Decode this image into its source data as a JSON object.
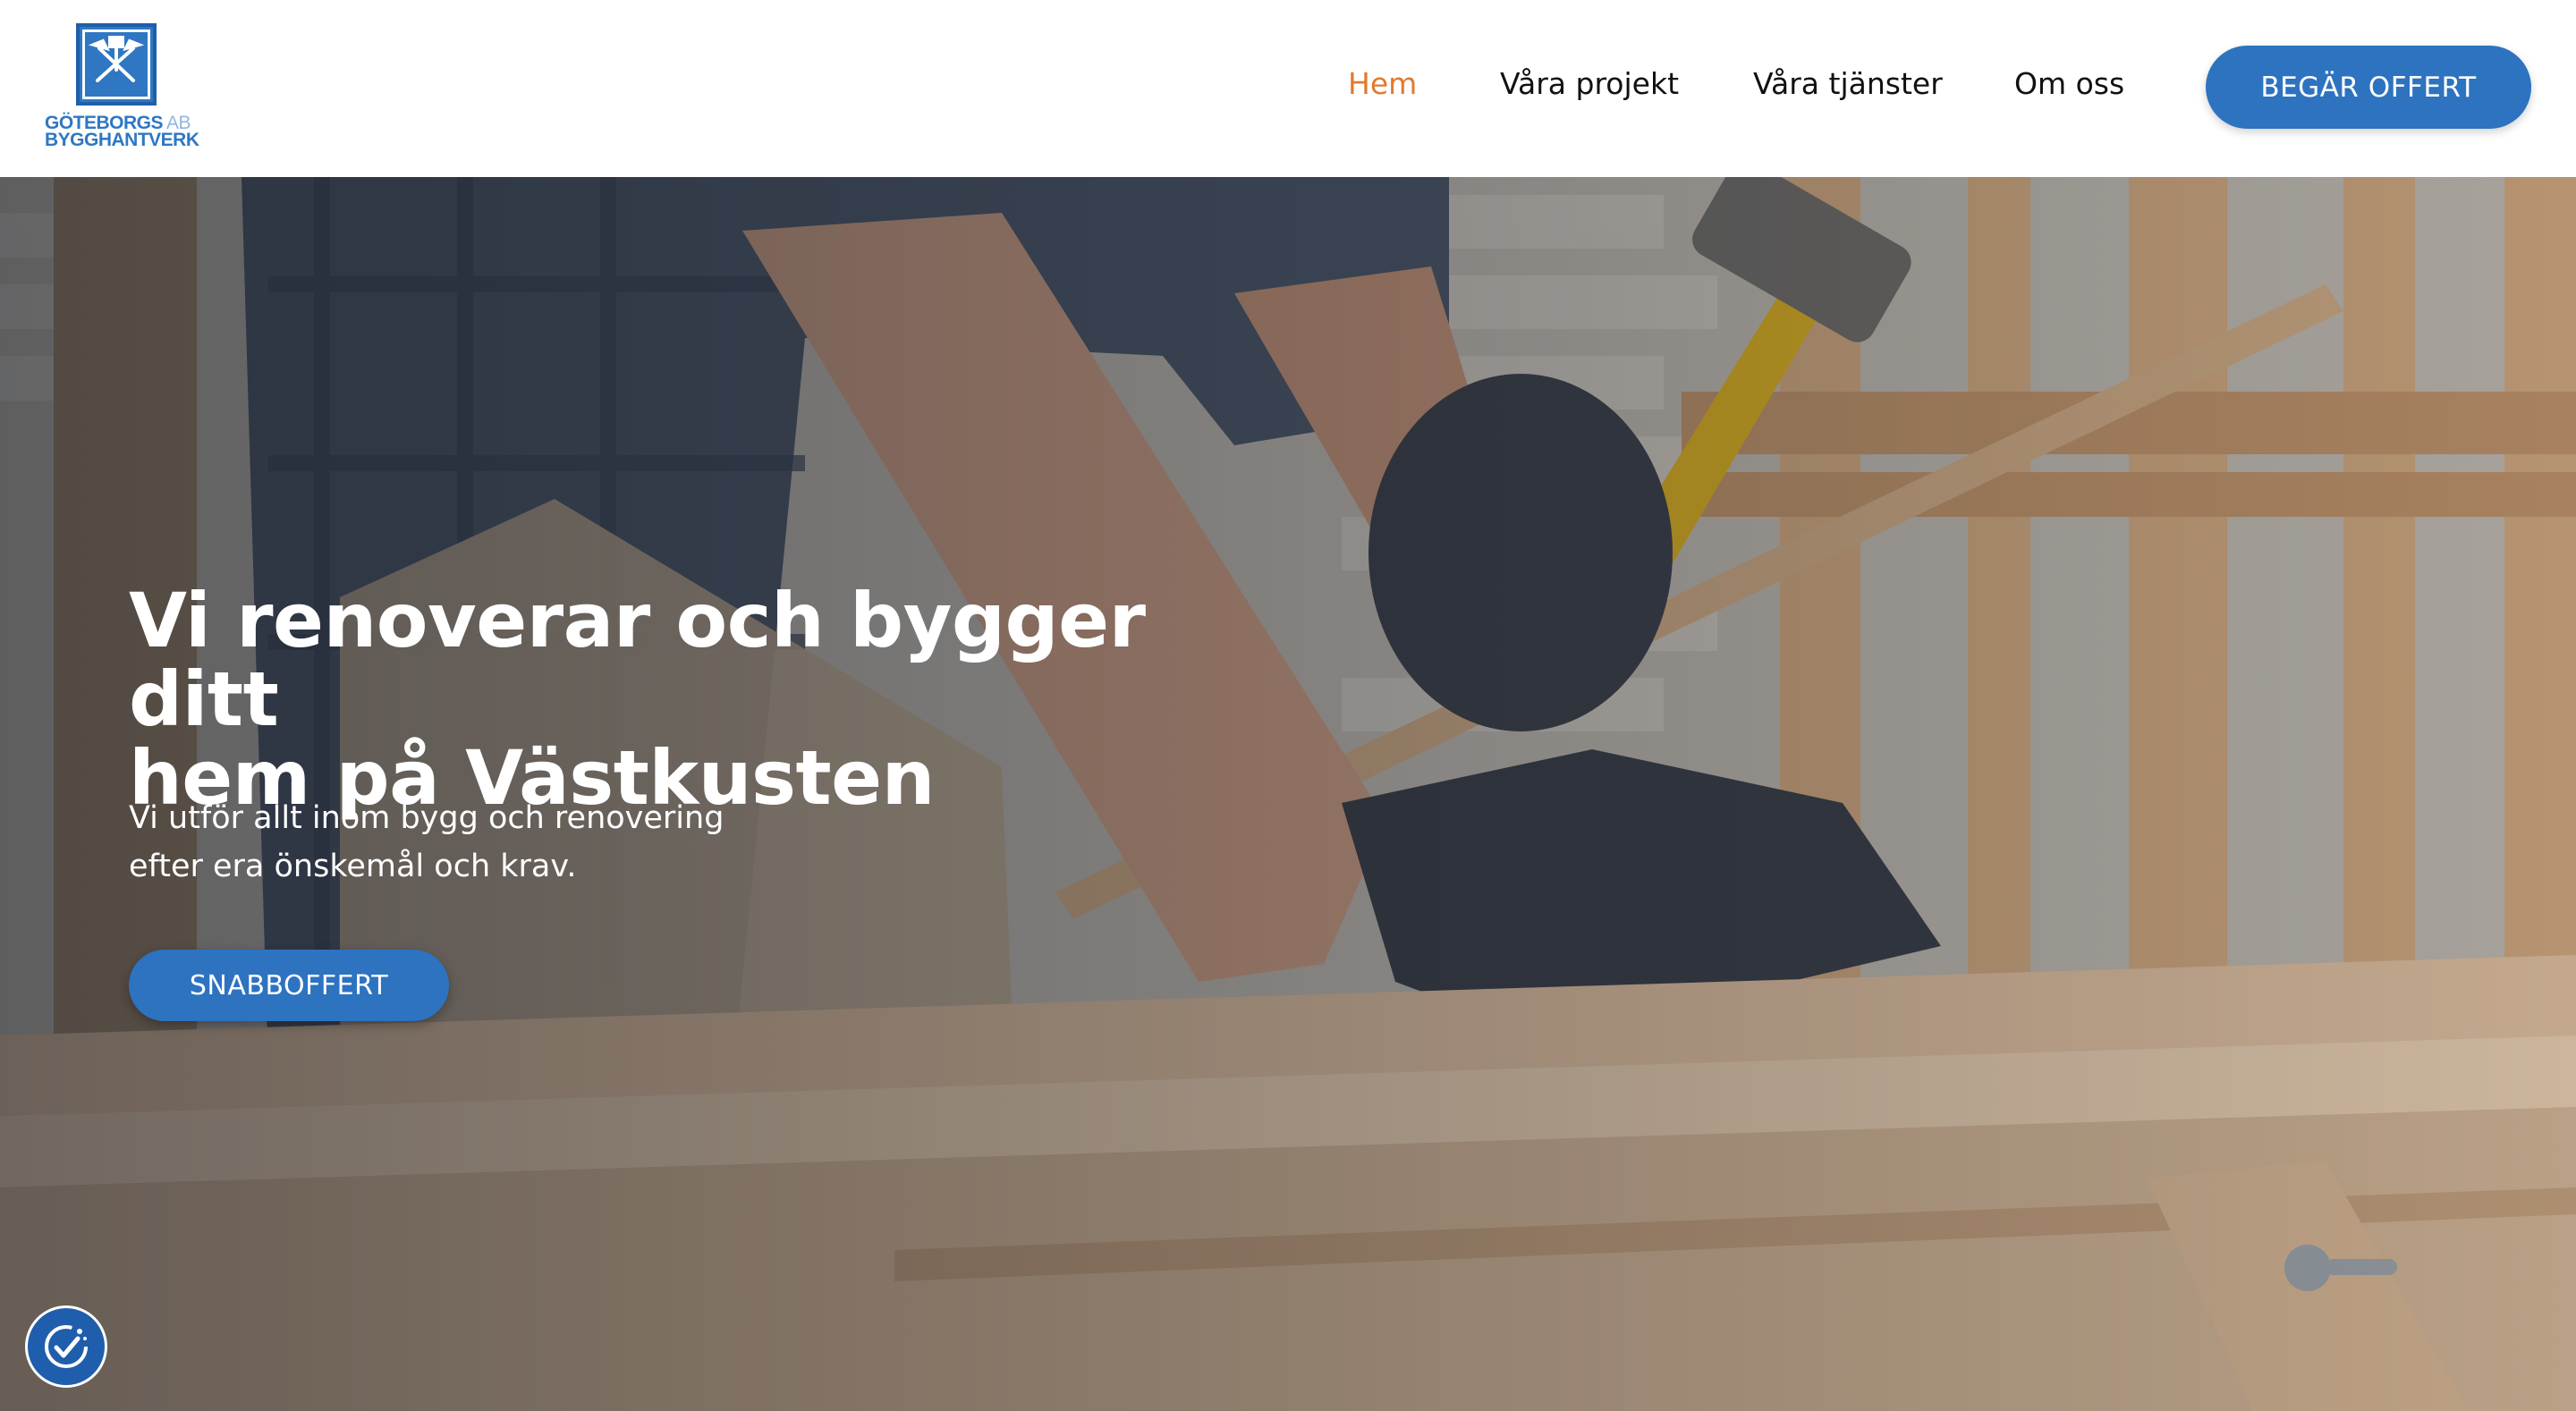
{
  "brand": {
    "line1": "GÖTEBORGS",
    "suffix": "AB",
    "line2": "BYGGHANTVERK",
    "color": "#2f77c3"
  },
  "nav": {
    "items": [
      {
        "label": "Hem",
        "active": true
      },
      {
        "label": "Våra projekt",
        "active": false
      },
      {
        "label": "Våra tjänster",
        "active": false
      },
      {
        "label": "Om oss",
        "active": false
      }
    ],
    "active_color": "#e17a2f"
  },
  "header_cta": {
    "label": "BEGÄR OFFERT"
  },
  "hero": {
    "title_line1": "Vi renoverar och bygger ditt",
    "title_line2": "hem på Västkusten",
    "subtitle_line1": "Vi utför allt inom bygg och renovering",
    "subtitle_line2": "efter era önskemål och krav.",
    "cta_label": "SNABBOFFERT",
    "image_subject": "carpenter-hammering-wood-photo"
  },
  "accessibility": {
    "icon": "accessibility-icon"
  },
  "colors": {
    "primary_button": "#2d73c0",
    "accent": "#e17a2f"
  }
}
